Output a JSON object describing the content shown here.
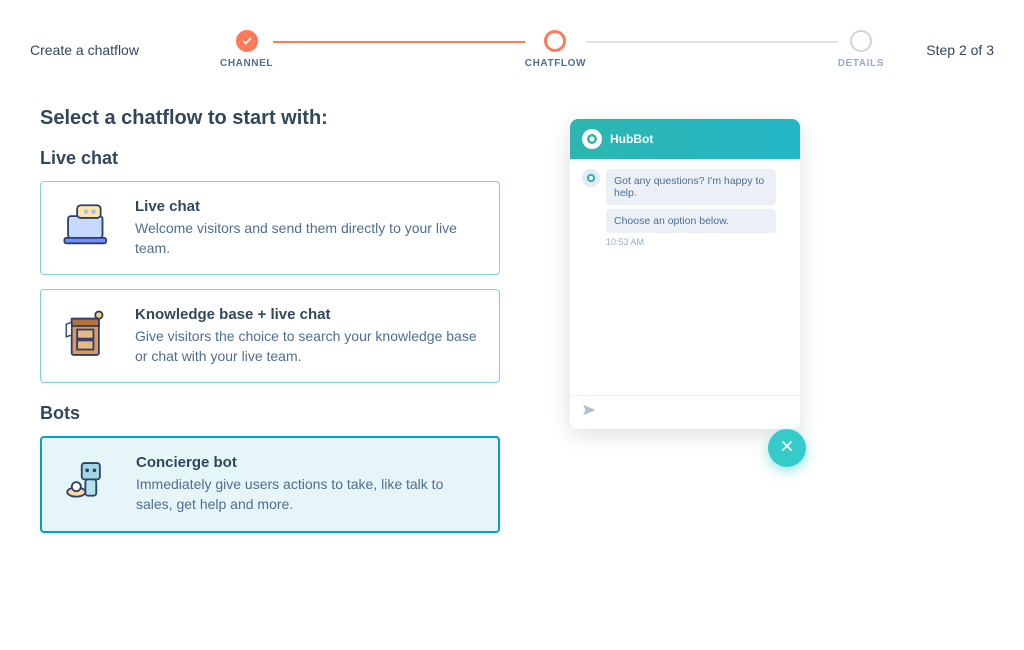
{
  "header": {
    "title": "Create a chatflow",
    "step_text": "Step 2 of 3",
    "steps": [
      {
        "label": "CHANNEL"
      },
      {
        "label": "CHATFLOW"
      },
      {
        "label": "DETAILS"
      }
    ]
  },
  "main": {
    "heading": "Select a chatflow to start with:",
    "sections": {
      "live_chat": {
        "title": "Live chat",
        "cards": [
          {
            "title": "Live chat",
            "desc": "Welcome visitors and send them directly to your live team."
          },
          {
            "title": "Knowledge base + live chat",
            "desc": "Give visitors the choice to search your knowledge base or chat with your live team."
          }
        ]
      },
      "bots": {
        "title": "Bots",
        "cards": [
          {
            "title": "Concierge bot",
            "desc": "Immediately give users actions to take, like talk to sales, get help and more."
          }
        ]
      }
    }
  },
  "preview": {
    "bot_name": "HubBot",
    "messages": [
      "Got any questions? I'm happy to help.",
      "Choose an option below."
    ],
    "timestamp": "10:53 AM"
  }
}
